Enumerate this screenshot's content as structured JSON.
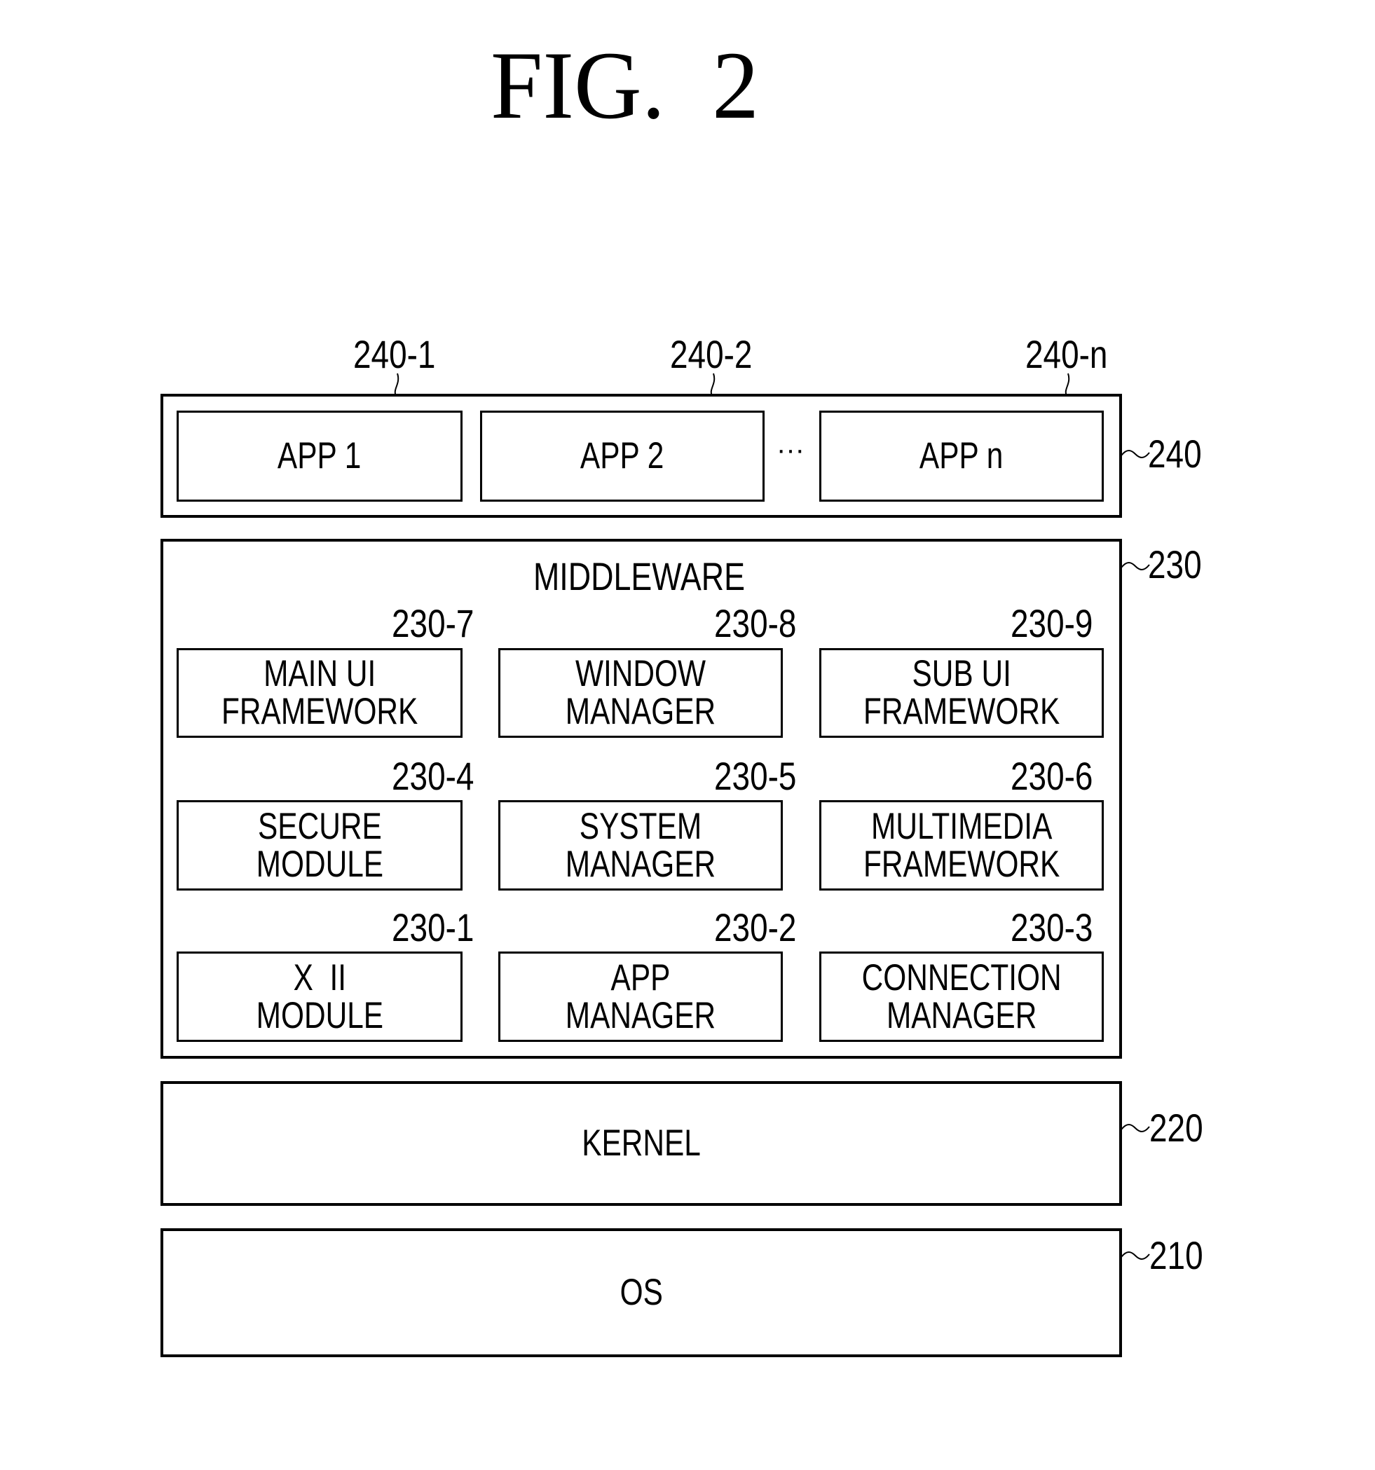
{
  "figure": {
    "title": "FIG.  2"
  },
  "layers": {
    "apps": {
      "ref": "240",
      "items": [
        {
          "ref": "240-1",
          "label": "APP 1"
        },
        {
          "ref": "240-2",
          "label": "APP 2"
        },
        {
          "ref": "240-n",
          "label": "APP n"
        }
      ],
      "ellipsis": "···"
    },
    "middleware": {
      "ref": "230",
      "title": "MIDDLEWARE",
      "modules": [
        {
          "ref": "230-7",
          "lines": [
            "MAIN UI",
            "FRAMEWORK"
          ]
        },
        {
          "ref": "230-8",
          "lines": [
            "WINDOW",
            "MANAGER"
          ]
        },
        {
          "ref": "230-9",
          "lines": [
            "SUB UI",
            "FRAMEWORK"
          ]
        },
        {
          "ref": "230-4",
          "lines": [
            "SECURE",
            "MODULE"
          ]
        },
        {
          "ref": "230-5",
          "lines": [
            "SYSTEM",
            "MANAGER"
          ]
        },
        {
          "ref": "230-6",
          "lines": [
            "MULTIMEDIA",
            "FRAMEWORK"
          ]
        },
        {
          "ref": "230-1",
          "lines": [
            "X  II",
            "MODULE"
          ]
        },
        {
          "ref": "230-2",
          "lines": [
            "APP",
            "MANAGER"
          ]
        },
        {
          "ref": "230-3",
          "lines": [
            "CONNECTION",
            "MANAGER"
          ]
        }
      ]
    },
    "kernel": {
      "ref": "220",
      "label": "KERNEL"
    },
    "os": {
      "ref": "210",
      "label": "OS"
    }
  },
  "ref_prefix": "~"
}
